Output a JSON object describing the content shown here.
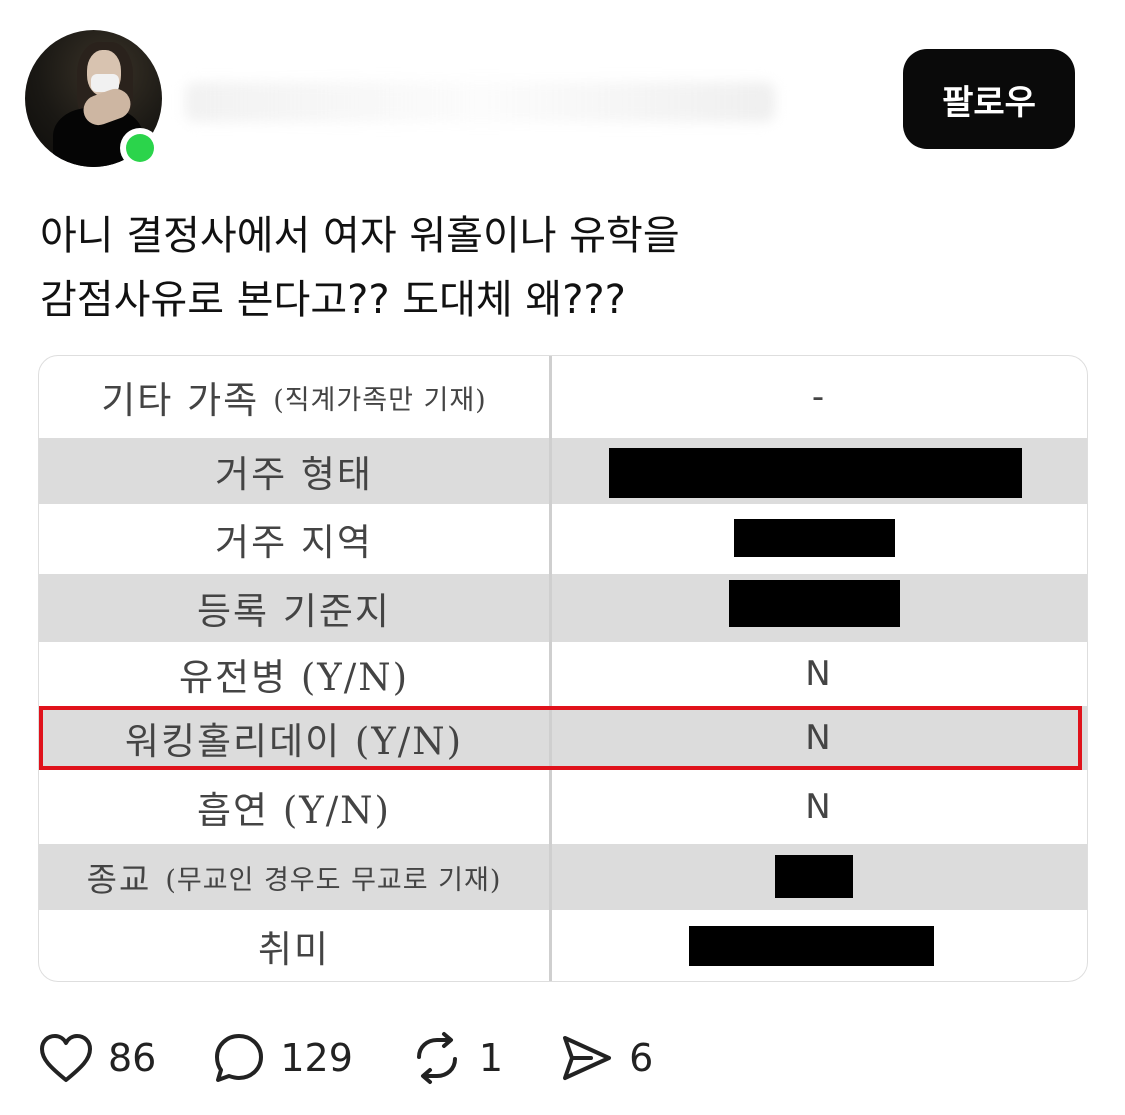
{
  "header": {
    "follow_label": "팔로우"
  },
  "post": {
    "lines": [
      "아니 결정사에서 여자 워홀이나 유학을",
      "감점사유로 본다고?? 도대체 왜???"
    ]
  },
  "table": {
    "rows": [
      {
        "label": "기타 가족",
        "note": "(직계가족만 기재)",
        "value": "-",
        "redacted": false,
        "shaded": false
      },
      {
        "label": "거주 형태",
        "note": "",
        "value": "",
        "redacted": true,
        "shaded": true
      },
      {
        "label": "거주 지역",
        "note": "",
        "value": "",
        "redacted": true,
        "shaded": false
      },
      {
        "label": "등록 기준지",
        "note": "",
        "value": "",
        "redacted": true,
        "shaded": true
      },
      {
        "label": "유전병 (Y/N)",
        "note": "",
        "value": "N",
        "redacted": false,
        "shaded": false
      },
      {
        "label": "워킹홀리데이 (Y/N)",
        "note": "",
        "value": "N",
        "redacted": false,
        "shaded": true,
        "highlighted": true
      },
      {
        "label": "흡연 (Y/N)",
        "note": "",
        "value": "N",
        "redacted": false,
        "shaded": false
      },
      {
        "label": "종교",
        "note": "(무교인 경우도 무교로 기재)",
        "value": "",
        "redacted": true,
        "shaded": true
      },
      {
        "label": "취미",
        "note": "",
        "value": "",
        "redacted": true,
        "shaded": false
      }
    ],
    "highlight_color": "#e0121b"
  },
  "actions": {
    "likes": "86",
    "comments": "129",
    "reposts": "1",
    "shares": "6"
  },
  "colors": {
    "follow_bg": "#0a0a0a",
    "online": "#2bd44b"
  }
}
